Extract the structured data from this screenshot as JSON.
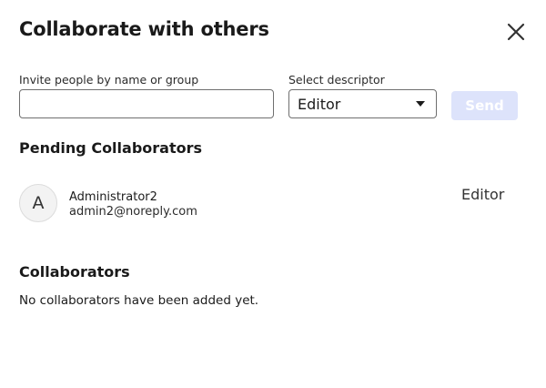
{
  "dialog": {
    "title": "Collaborate with others",
    "close_icon": "close-icon"
  },
  "invite": {
    "label": "Invite people by name or group",
    "value": "",
    "placeholder": ""
  },
  "descriptor": {
    "label": "Select descriptor",
    "selected": "Editor",
    "icon": "caret-down-icon"
  },
  "send_button": {
    "label": "Send",
    "state": "disabled",
    "background": "#dde3fb"
  },
  "pending": {
    "title": "Pending Collaborators",
    "items": [
      {
        "avatar_initial": "A",
        "name": "Administrator2",
        "email": "admin2@noreply.com",
        "role": "Editor"
      }
    ]
  },
  "collaborators": {
    "title": "Collaborators",
    "empty_message": "No collaborators have been added yet."
  }
}
